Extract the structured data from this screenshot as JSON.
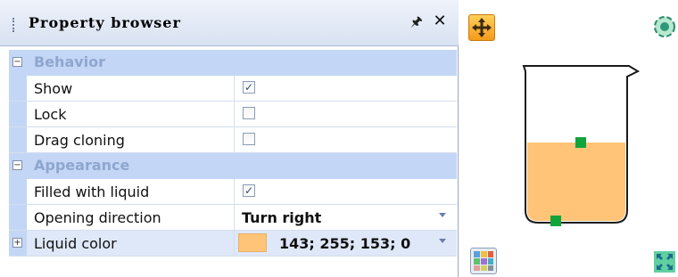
{
  "panel": {
    "title": "Property browser",
    "pin_icon": "pin-icon",
    "close_icon": "close-icon"
  },
  "categories": [
    {
      "label": "Behavior",
      "expander": "⊟",
      "properties": [
        {
          "name": "Show",
          "type": "checkbox",
          "checked": true
        },
        {
          "name": "Lock",
          "type": "checkbox",
          "checked": false
        },
        {
          "name": "Drag cloning",
          "type": "checkbox",
          "checked": false
        }
      ]
    },
    {
      "label": "Appearance",
      "expander": "⊟",
      "properties": [
        {
          "name": "Filled with liquid",
          "type": "checkbox",
          "checked": true
        },
        {
          "name": "Opening direction",
          "type": "dropdown",
          "value": "Turn right"
        },
        {
          "name": "Liquid color",
          "type": "color",
          "value": "143; 255; 153; 0",
          "swatch": "#ffc477",
          "expander": "⊞"
        }
      ]
    }
  ],
  "canvas": {
    "liquid_color": "#ffc477",
    "handle_color": "#11a43a",
    "icons": [
      "move-icon",
      "rotate-icon",
      "palette-icon",
      "fit-to-window-icon"
    ]
  }
}
